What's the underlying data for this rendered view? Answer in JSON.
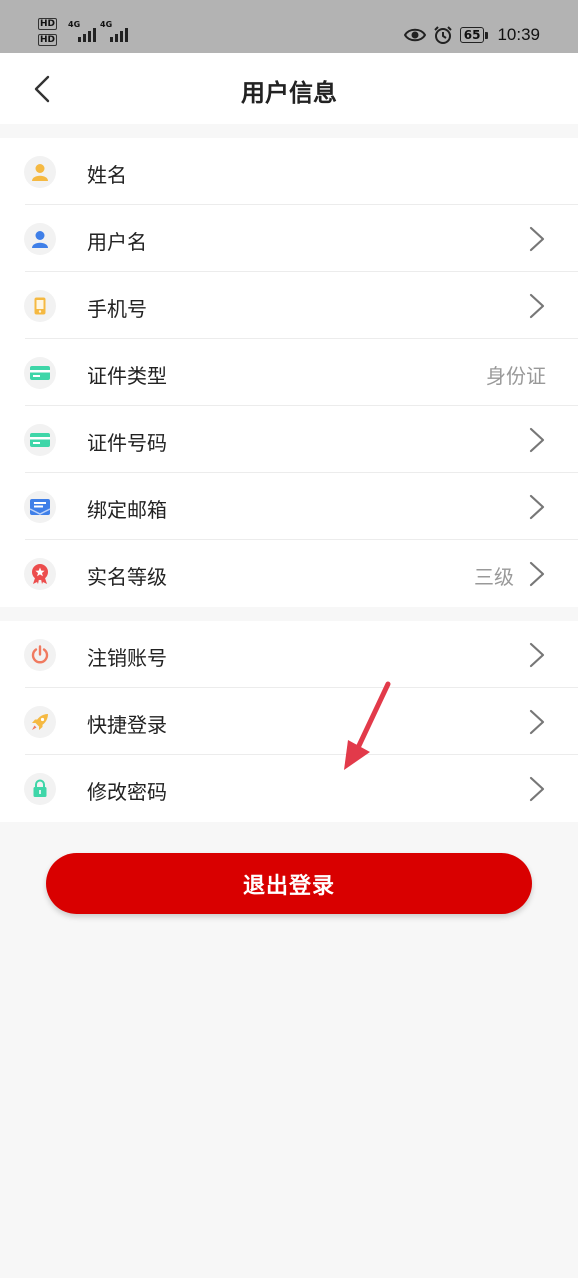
{
  "status_bar": {
    "hd1": "HD",
    "hd2": "HD",
    "signal1": "4G",
    "signal2": "4G",
    "battery": "65",
    "time": "10:39",
    "icons": [
      "eye-icon",
      "alarm-icon"
    ]
  },
  "header": {
    "title": "用户信息",
    "back_icon": "chevron-left-icon"
  },
  "profile_items": [
    {
      "label": "姓名",
      "value": "",
      "icon": "user-icon",
      "icon_color": "#f5b942",
      "chevron": false
    },
    {
      "label": "用户名",
      "value": "",
      "icon": "user-icon",
      "icon_color": "#3f7fe8",
      "chevron": true
    },
    {
      "label": "手机号",
      "value": "",
      "icon": "phone-icon",
      "icon_color": "#f5b942",
      "chevron": true
    },
    {
      "label": "证件类型",
      "value": "身份证",
      "icon": "id-card-icon",
      "icon_color": "#3ed6a8",
      "chevron": false
    },
    {
      "label": "证件号码",
      "value": "",
      "icon": "id-card-icon",
      "icon_color": "#3ed6a8",
      "chevron": true
    },
    {
      "label": "绑定邮箱",
      "value": "",
      "icon": "mail-icon",
      "icon_color": "#3f7fe8",
      "chevron": true
    },
    {
      "label": "实名等级",
      "value": "三级",
      "icon": "badge-icon",
      "icon_color": "#ec4d4d",
      "chevron": true
    }
  ],
  "account_items": [
    {
      "label": "注销账号",
      "icon": "power-icon",
      "icon_color": "#f07a60",
      "chevron": true
    },
    {
      "label": "快捷登录",
      "icon": "rocket-icon",
      "icon_color": "#f5b942",
      "chevron": true
    },
    {
      "label": "修改密码",
      "icon": "lock-icon",
      "icon_color": "#3ed6a8",
      "chevron": true
    }
  ],
  "logout_label": "退出登录",
  "colors": {
    "accent_red": "#d90000",
    "annotation_arrow": "#e23a4a"
  }
}
